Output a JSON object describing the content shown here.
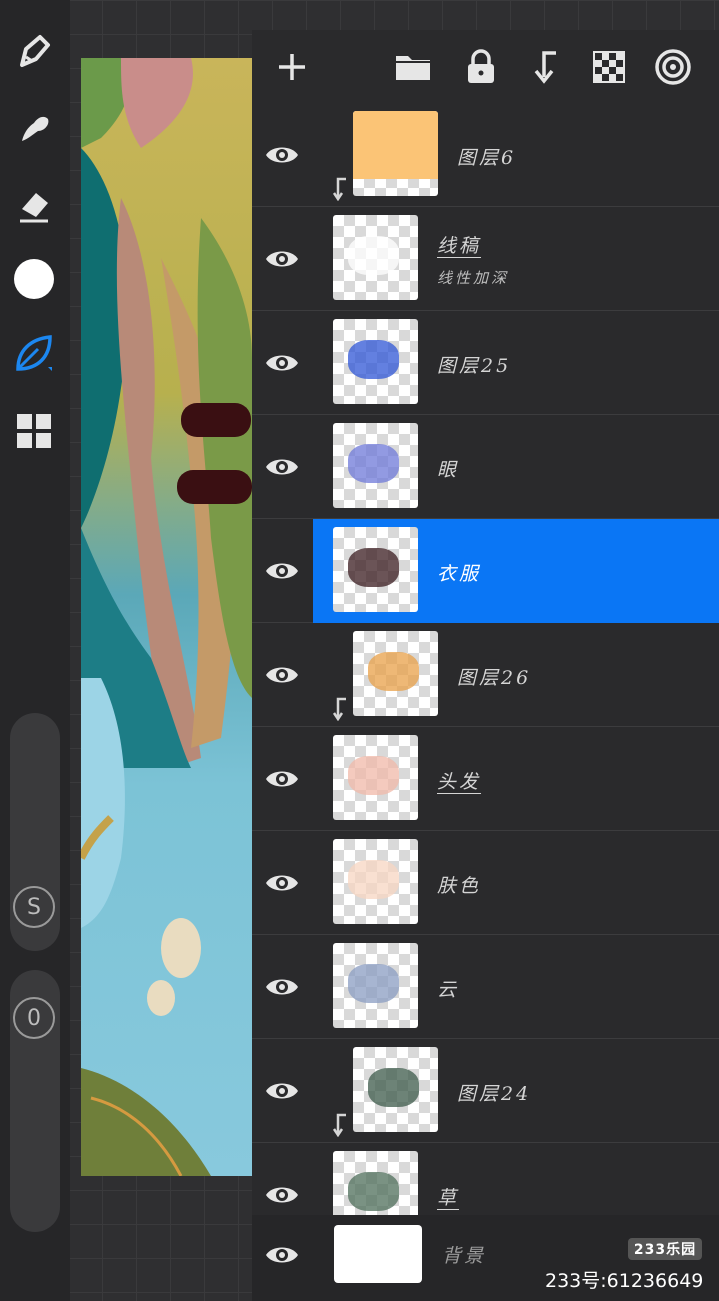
{
  "toolbar": {
    "tools": [
      "brush-icon",
      "smudge-icon",
      "eraser-icon",
      "color-swatch",
      "selection-leaf-icon",
      "gallery-grid-icon"
    ],
    "active_tool": "selection-leaf-icon",
    "primary_color": "#ffffff",
    "size_knob_label": "S",
    "opacity_knob_label": "0"
  },
  "panel_header": {
    "buttons": [
      "add-layer",
      "folder",
      "lock",
      "merge-down",
      "checkerboard",
      "target"
    ]
  },
  "layers": [
    {
      "name": "图层6",
      "sub": "",
      "underline": false,
      "clipped": true,
      "selected": false,
      "thumb_color": "#fbc476"
    },
    {
      "name": "线稿",
      "sub": "线性加深",
      "underline": true,
      "clipped": false,
      "selected": false,
      "thumb_color": "#ffffff"
    },
    {
      "name": "图层25",
      "sub": "",
      "underline": false,
      "clipped": false,
      "selected": false,
      "thumb_color": "#2f55d6"
    },
    {
      "name": "眼",
      "sub": "",
      "underline": false,
      "clipped": false,
      "selected": false,
      "thumb_color": "#6e78d8"
    },
    {
      "name": "衣服",
      "sub": "",
      "underline": false,
      "clipped": false,
      "selected": true,
      "thumb_color": "#3a1b1f"
    },
    {
      "name": "图层26",
      "sub": "",
      "underline": false,
      "clipped": true,
      "selected": false,
      "thumb_color": "#e8a048"
    },
    {
      "name": "头发",
      "sub": "",
      "underline": true,
      "clipped": false,
      "selected": false,
      "thumb_color": "#f0b8a8"
    },
    {
      "name": "肤色",
      "sub": "",
      "underline": false,
      "clipped": false,
      "selected": false,
      "thumb_color": "#f7d6c2"
    },
    {
      "name": "云",
      "sub": "",
      "underline": false,
      "clipped": false,
      "selected": false,
      "thumb_color": "#8a9cc2"
    },
    {
      "name": "图层24",
      "sub": "",
      "underline": false,
      "clipped": true,
      "selected": false,
      "thumb_color": "#3c5a4a"
    },
    {
      "name": "草",
      "sub": "",
      "underline": true,
      "clipped": false,
      "selected": false,
      "thumb_color": "#4e6e5a"
    }
  ],
  "background_layer": {
    "name": "背景",
    "color": "#ffffff"
  },
  "watermark": {
    "logo": "233乐园",
    "text": "233号:61236649"
  },
  "colors": {
    "accent": "#0a76f5"
  }
}
